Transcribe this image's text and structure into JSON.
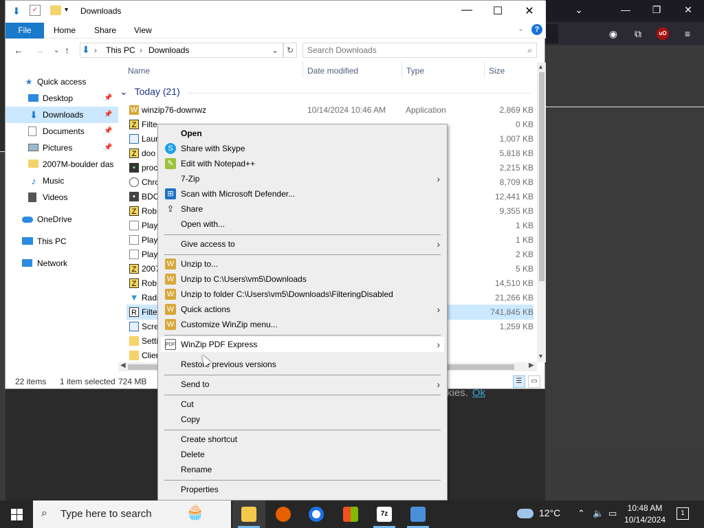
{
  "explorer": {
    "title": "Downloads",
    "ribbon_tabs": [
      "File",
      "Home",
      "Share",
      "View"
    ],
    "address": [
      "This PC",
      "Downloads"
    ],
    "search_placeholder": "Search Downloads",
    "columns": [
      "Name",
      "Date modified",
      "Type",
      "Size"
    ],
    "group_label": "Today (21)",
    "nav_items": [
      {
        "label": "Quick access",
        "icon": "star-icon"
      },
      {
        "label": "Desktop",
        "icon": "desktop-icon"
      },
      {
        "label": "Downloads",
        "icon": "download-icon"
      },
      {
        "label": "Documents",
        "icon": "documents-icon"
      },
      {
        "label": "Pictures",
        "icon": "pictures-icon"
      },
      {
        "label": "2007M-boulder das",
        "icon": "folder-icon"
      },
      {
        "label": "Music",
        "icon": "music-icon"
      },
      {
        "label": "Videos",
        "icon": "videos-icon"
      },
      {
        "label": "OneDrive",
        "icon": "cloud-icon"
      },
      {
        "label": "This PC",
        "icon": "pc-icon"
      },
      {
        "label": "Network",
        "icon": "network-icon"
      }
    ],
    "files": [
      {
        "name": "winzip76-downwz",
        "date": "10/14/2024 10:46 AM",
        "type": "Application",
        "size": "2,869 KB"
      },
      {
        "name": "Filte",
        "date": "",
        "type": "",
        "size": "0 KB"
      },
      {
        "name": "Laur",
        "date": "",
        "type": "",
        "size": "1,007 KB"
      },
      {
        "name": "doo",
        "date": "",
        "type": "",
        "size": "5,818 KB"
      },
      {
        "name": "proc",
        "date": "",
        "type": "",
        "size": "2,215 KB"
      },
      {
        "name": "Chro",
        "date": "",
        "type": "",
        "size": "8,709 KB"
      },
      {
        "name": "BDC",
        "date": "",
        "type": "",
        "size": "12,441 KB"
      },
      {
        "name": "Rob",
        "date": "",
        "type": "",
        "size": "9,355 KB"
      },
      {
        "name": "Play",
        "date": "",
        "type": "",
        "size": "1 KB"
      },
      {
        "name": "Play",
        "date": "",
        "type": "",
        "size": "1 KB"
      },
      {
        "name": "Play",
        "date": "",
        "type": "",
        "size": "2 KB"
      },
      {
        "name": "2007",
        "date": "",
        "type": "",
        "size": "5 KB"
      },
      {
        "name": "Rob",
        "date": "",
        "type": "",
        "size": "14,510 KB"
      },
      {
        "name": "Radi",
        "date": "",
        "type": "",
        "size": "21,266 KB"
      },
      {
        "name": "Filte",
        "date": "",
        "type": "",
        "size": "741,845 KB"
      },
      {
        "name": "Scre",
        "date": "",
        "type": "",
        "size": "1,259 KB"
      },
      {
        "name": "Setti",
        "date": "",
        "type": "",
        "size": ""
      },
      {
        "name": "Clier",
        "date": "",
        "type": "",
        "size": ""
      }
    ],
    "status": {
      "items": "22 items",
      "selected": "1 item selected",
      "size": "724 MB"
    }
  },
  "context_menu": {
    "items": [
      {
        "label": "Open",
        "bold": true,
        "icon": ""
      },
      {
        "label": "Share with Skype",
        "icon": "skype-icon"
      },
      {
        "label": "Edit with Notepad++",
        "icon": "notepad-plus-plus-icon"
      },
      {
        "label": "7-Zip",
        "submenu": true,
        "icon": ""
      },
      {
        "label": "Scan with Microsoft Defender...",
        "icon": "defender-icon"
      },
      {
        "label": "Share",
        "icon": "share-icon"
      },
      {
        "label": "Open with...",
        "icon": ""
      },
      {
        "label": "Give access to",
        "submenu": true,
        "icon": ""
      },
      {
        "label": "Unzip to...",
        "icon": "winzip-icon"
      },
      {
        "label": "Unzip to C:\\Users\\vm5\\Downloads",
        "icon": "winzip-icon"
      },
      {
        "label": "Unzip to folder C:\\Users\\vm5\\Downloads\\FilteringDisabled",
        "icon": "winzip-icon"
      },
      {
        "label": "Quick actions",
        "submenu": true,
        "icon": "winzip-icon"
      },
      {
        "label": "Customize WinZip menu...",
        "icon": "winzip-icon"
      },
      {
        "label": "WinZip PDF Express",
        "submenu": true,
        "icon": "pdf-icon"
      },
      {
        "label": "Restore previous versions",
        "icon": ""
      },
      {
        "label": "Send to",
        "submenu": true,
        "icon": ""
      },
      {
        "label": "Cut",
        "icon": ""
      },
      {
        "label": "Copy",
        "icon": ""
      },
      {
        "label": "Create shortcut",
        "icon": ""
      },
      {
        "label": "Delete",
        "icon": ""
      },
      {
        "label": "Rename",
        "icon": ""
      },
      {
        "label": "Properties",
        "icon": ""
      }
    ]
  },
  "background": {
    "cookie_text": "kies.",
    "cookie_ok": "Ok"
  },
  "taskbar": {
    "search_placeholder": "Type here to search",
    "weather": "12°C",
    "time": "10:48 AM",
    "date": "10/14/2024",
    "notification_count": "1",
    "apps": [
      "file-explorer-icon",
      "firefox-icon",
      "chrome-icon",
      "windows-store-icon",
      "7zip-icon",
      "installer-icon"
    ]
  },
  "colors": {
    "accent": "#1979ca",
    "selection": "#cce8ff",
    "menu_bg": "#eeeeee"
  }
}
